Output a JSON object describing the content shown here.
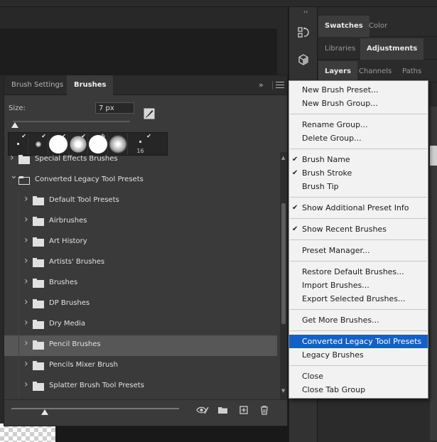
{
  "right_dock": {
    "collapse_glyph": "‹‹",
    "tabs_row1": [
      "Swatches",
      "Color"
    ],
    "tabs_row2": [
      "Libraries",
      "Adjustments"
    ],
    "tabs_row3": [
      "Layers",
      "Channels",
      "Paths"
    ]
  },
  "brushes_panel": {
    "tabs": [
      "Brush Settings",
      "Brushes"
    ],
    "collapse_glyph": "»",
    "size_label": "Size:",
    "size_value": "7 px",
    "size_level_fraction": 0.02,
    "recent_brush_last_number": "16",
    "rows": [
      {
        "label": "Special Effects Brushes",
        "level": 0,
        "expanded": false
      },
      {
        "label": "Converted Legacy Tool Presets",
        "level": 0,
        "expanded": true
      },
      {
        "label": "Default Tool Presets",
        "level": 1,
        "expanded": false
      },
      {
        "label": "Airbrushes",
        "level": 1,
        "expanded": false
      },
      {
        "label": "Art History",
        "level": 1,
        "expanded": false
      },
      {
        "label": "Artists' Brushes",
        "level": 1,
        "expanded": false
      },
      {
        "label": "Brushes",
        "level": 1,
        "expanded": false
      },
      {
        "label": "DP Brushes",
        "level": 1,
        "expanded": false
      },
      {
        "label": "Dry Media",
        "level": 1,
        "expanded": false
      },
      {
        "label": "Pencil Brushes",
        "level": 1,
        "expanded": false,
        "selected": true
      },
      {
        "label": "Pencils Mixer Brush",
        "level": 1,
        "expanded": false
      },
      {
        "label": "Splatter Brush Tool Presets",
        "level": 1,
        "expanded": false
      }
    ],
    "preview_level_fraction": 0.2
  },
  "menu": {
    "items": [
      {
        "label": "New Brush Preset..."
      },
      {
        "label": "New Brush Group..."
      },
      {
        "separator": true
      },
      {
        "label": "Rename Group..."
      },
      {
        "label": "Delete Group..."
      },
      {
        "separator": true
      },
      {
        "label": "Brush Name",
        "checked": true
      },
      {
        "label": "Brush Stroke",
        "checked": true
      },
      {
        "label": "Brush Tip"
      },
      {
        "separator": true
      },
      {
        "label": "Show Additional Preset Info",
        "checked": true
      },
      {
        "separator": true
      },
      {
        "label": "Show Recent Brushes",
        "checked": true
      },
      {
        "separator": true
      },
      {
        "label": "Preset Manager..."
      },
      {
        "separator": true
      },
      {
        "label": "Restore Default Brushes..."
      },
      {
        "label": "Import Brushes..."
      },
      {
        "label": "Export Selected Brushes..."
      },
      {
        "separator": true
      },
      {
        "label": "Get More Brushes..."
      },
      {
        "separator": true
      },
      {
        "label": "Converted Legacy Tool Presets",
        "highlighted": true
      },
      {
        "label": "Legacy Brushes"
      },
      {
        "separator": true
      },
      {
        "label": "Close"
      },
      {
        "label": "Close Tab Group"
      }
    ],
    "highlight_color": "#1560c4"
  }
}
